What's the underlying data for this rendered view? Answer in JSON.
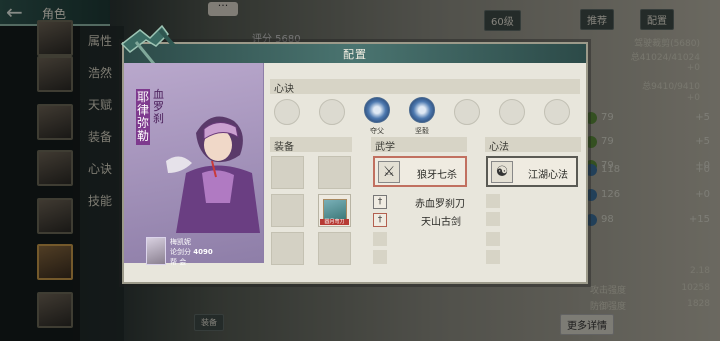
{
  "header": {
    "title": "角色"
  },
  "side_tabs": [
    "属性",
    "浩然",
    "天赋",
    "装备",
    "心诀",
    "技能"
  ],
  "background": {
    "power_label": "评分 5680",
    "level_badge": "60级",
    "btn_recommend": "推荐",
    "btn_config": "配置",
    "basic_attr_label": "基础属性",
    "basic_attr_value": "驾驶裁剪(5680)",
    "hp": "总41024/41024",
    "mp": "总9410/9410",
    "plus_zero_1": "+0",
    "plus_zero_2": "+0",
    "stats": [
      {
        "value": "79",
        "plus": "+5"
      },
      {
        "value": "79",
        "plus": "+5"
      },
      {
        "value": "79",
        "plus": "+0"
      },
      {
        "value": "118",
        "plus": "+0"
      },
      {
        "value": "126",
        "plus": "+0"
      },
      {
        "value": "98",
        "plus": "+15"
      }
    ],
    "right_stats": [
      {
        "label": "",
        "value": "2.18"
      },
      {
        "label": "攻击强度",
        "value": "10258"
      },
      {
        "label": "防御强度",
        "value": "1828"
      }
    ],
    "more_details": "更多详情",
    "bottom_tab": "装备"
  },
  "modal": {
    "title": "配置",
    "character": {
      "name": "耶律弥勒",
      "title": "血罗刹",
      "info_name": "梅凯妮",
      "info_rating_label": "论剑分",
      "info_rating": "4090",
      "info_extra": "帮    会"
    },
    "sections": {
      "heart_art": "心诀",
      "equipment": "装备",
      "martial": "武学",
      "mind_method": "心法"
    },
    "heart_slots": [
      {
        "filled": false,
        "label": ""
      },
      {
        "filled": false,
        "label": ""
      },
      {
        "filled": true,
        "label": "夺父"
      },
      {
        "filled": true,
        "label": "坚毅"
      },
      {
        "filled": false,
        "label": ""
      },
      {
        "filled": false,
        "label": ""
      },
      {
        "filled": false,
        "label": ""
      }
    ],
    "equip_item_tag": "圆月弯刀",
    "martial": {
      "main": "狼牙七杀",
      "sub": [
        "赤血罗刹刀",
        "天山古剑"
      ]
    },
    "mind": {
      "main": "江湖心法"
    }
  }
}
